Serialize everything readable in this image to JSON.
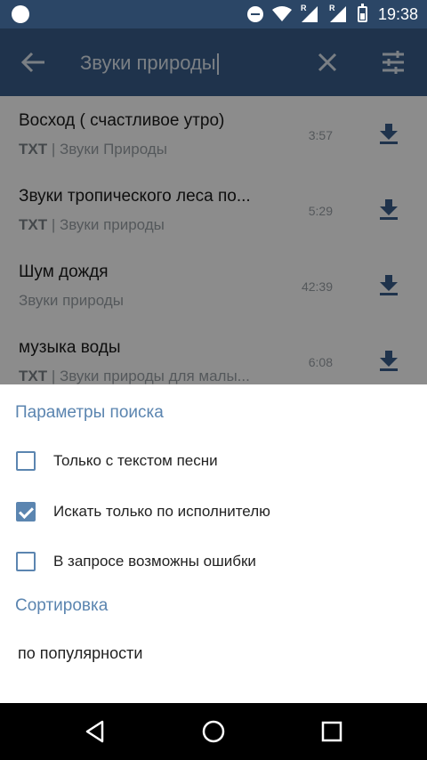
{
  "status_bar": {
    "time": "19:38",
    "signal_badge_1": "R",
    "signal_badge_2": "R"
  },
  "toolbar": {
    "search_value": "Звуки природы",
    "back_icon": "arrow-left-icon",
    "clear_icon": "close-icon",
    "filter_icon": "tune-icon"
  },
  "tracks": [
    {
      "title": "Восход ( счастливое утро)",
      "tag": "TXT",
      "artist": "Звуки Природы",
      "duration": "3:57"
    },
    {
      "title": "Звуки тропического леса по...",
      "tag": "TXT",
      "artist": "Звуки природы",
      "duration": "5:29"
    },
    {
      "title": "Шум дождя",
      "tag": "",
      "artist": "Звуки природы",
      "duration": "42:39"
    },
    {
      "title": "музыка воды",
      "tag": "TXT",
      "artist": "Звуки природы для малы...",
      "duration": "6:08"
    }
  ],
  "separator": " | ",
  "sheet": {
    "search_params_heading": "Параметры поиска",
    "options": [
      {
        "label": "Только с текстом песни",
        "checked": false
      },
      {
        "label": "Искать только по исполнителю",
        "checked": true
      },
      {
        "label": "В запросе возможны ошибки",
        "checked": false
      }
    ],
    "sort_heading": "Сортировка",
    "sort_value": "по популярности"
  },
  "colors": {
    "status_bar": "#2b4666",
    "toolbar": "#3a5e8a",
    "accent": "#5b85b0"
  }
}
